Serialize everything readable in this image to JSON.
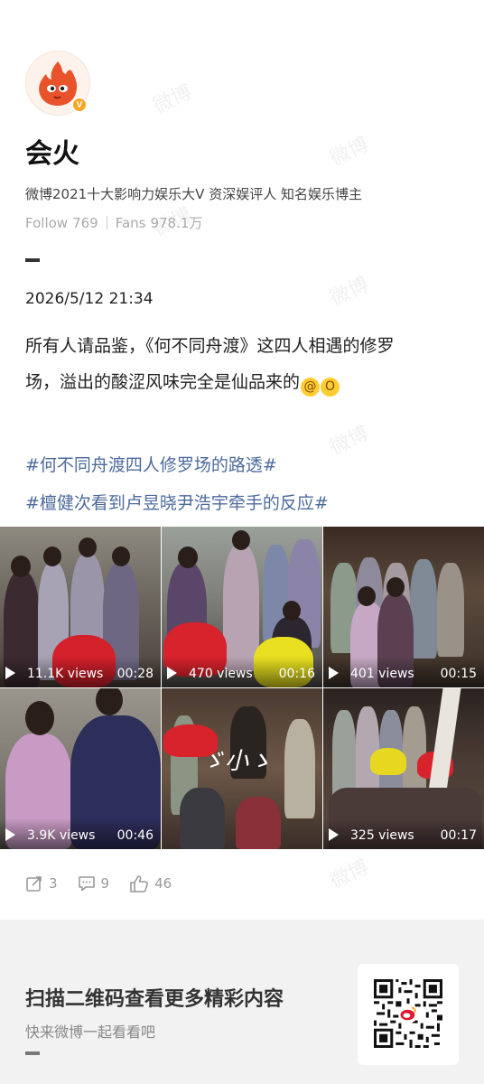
{
  "watermark_text": "微博",
  "profile": {
    "avatar_icon": "flame-mascot-icon",
    "verified_badge": "V",
    "name": "会火",
    "bio": "微博2021十大影响力娱乐大V 资深娱评人 知名娱乐博主",
    "follow_label": "Follow",
    "follow_count": "769",
    "fans_label": "Fans",
    "fans_count": "978.1万"
  },
  "post": {
    "date": "2026/5/12 21:34",
    "text_line1": "所有人请品鉴，《何不同舟渡》这四人相遇的修罗",
    "text_line2": "场，溢出的酸涩风味完全是仙品来的",
    "emojis": [
      "dizzy-face-emoji",
      "shocked-face-emoji"
    ],
    "hashtags": [
      "#何不同舟渡四人修罗场的路透#",
      "#檀健次看到卢昱晓尹浩宇牵手的反应#"
    ]
  },
  "videos": [
    {
      "views": "11.1K views",
      "duration": "00:28"
    },
    {
      "views": "470 views",
      "duration": "00:16"
    },
    {
      "views": "401 views",
      "duration": "00:15"
    },
    {
      "views": "3.9K views",
      "duration": "00:46"
    },
    {
      "views": "",
      "duration": ""
    },
    {
      "views": "325 views",
      "duration": "00:17"
    }
  ],
  "actions": {
    "share_count": "3",
    "comment_count": "9",
    "like_count": "46"
  },
  "footer": {
    "title": "扫描二维码查看更多精彩内容",
    "subtitle": "快来微博一起看看吧"
  },
  "colors": {
    "hashtag": "#4d6a9c",
    "verified": "#f5a623",
    "avatar_flame": "#e8532b"
  }
}
